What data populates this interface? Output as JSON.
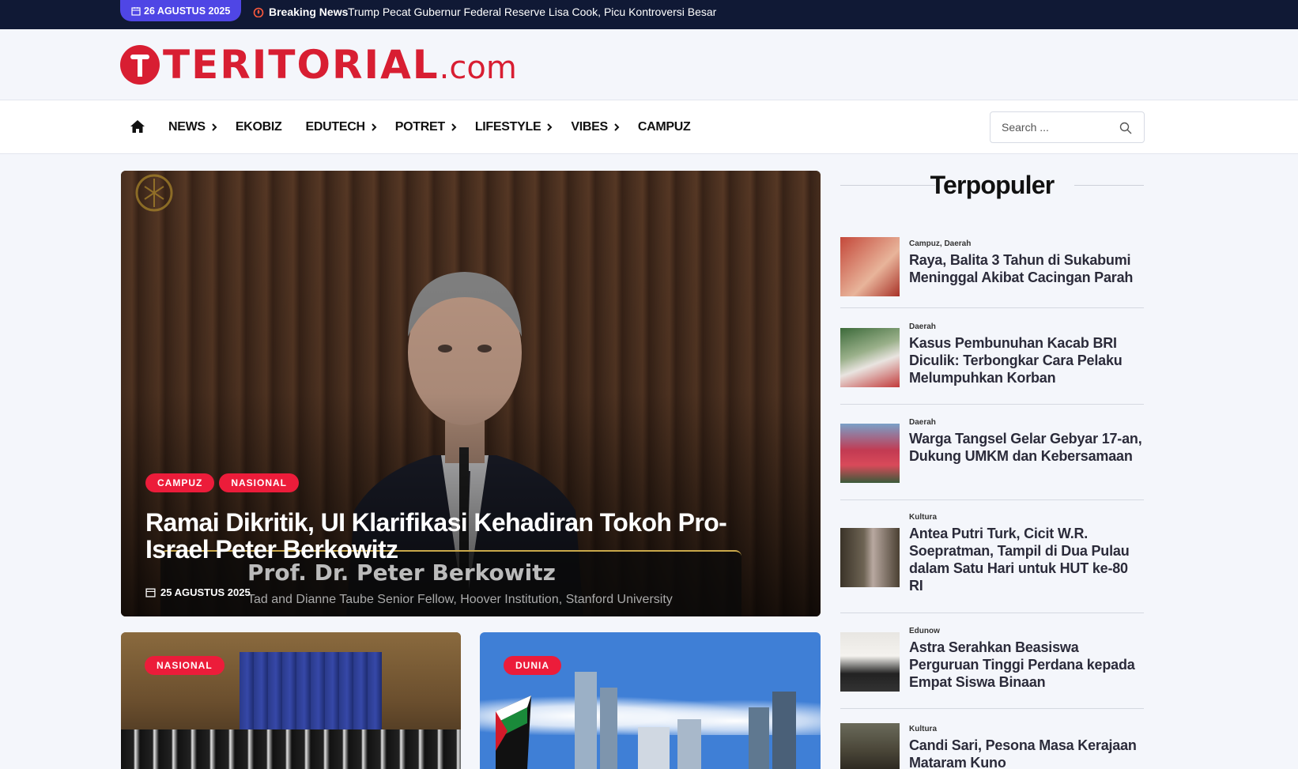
{
  "topbar": {
    "date": "26 AGUSTUS 2025",
    "breaking_label": "Breaking News",
    "ticker_text": "Trump Pecat Gubernur Federal Reserve Lisa Cook, Picu Kontroversi Besar"
  },
  "logo": {
    "main": "TERITORIAL",
    "suffix": ".com",
    "brand_color": "#d81e32"
  },
  "nav": {
    "home_icon": "home-icon",
    "items": [
      {
        "label": "NEWS",
        "has_submenu": true
      },
      {
        "label": "EKOBIZ",
        "has_submenu": false
      },
      {
        "label": "EDUTECH",
        "has_submenu": true
      },
      {
        "label": "POTRET",
        "has_submenu": true
      },
      {
        "label": "LIFESTYLE",
        "has_submenu": true
      },
      {
        "label": "VIBES",
        "has_submenu": true
      },
      {
        "label": "CAMPUZ",
        "has_submenu": false
      }
    ],
    "search_placeholder": "Search ..."
  },
  "hero": {
    "tags": [
      "CAMPUZ",
      "NASIONAL"
    ],
    "title": "Ramai Dikritik, UI Klarifikasi Kehadiran Tokoh Pro-Israel Peter Berkowitz",
    "date": "25 AGUSTUS 2025",
    "caption_name": "Prof. Dr. Peter Berkowitz",
    "caption_role": "Tad and Dianne Taube Senior Fellow, Hoover Institution, Stanford University"
  },
  "cards": [
    {
      "tag": "NASIONAL"
    },
    {
      "tag": "DUNIA"
    }
  ],
  "sidebar": {
    "title": "Terpopuler",
    "items": [
      {
        "category": "Campuz, Daerah",
        "title": "Raya, Balita 3 Tahun di Sukabumi Meninggal Akibat Cacingan Parah"
      },
      {
        "category": "Daerah",
        "title": "Kasus Pembunuhan Kacab BRI Diculik: Terbongkar Cara Pelaku Melumpuhkan Korban"
      },
      {
        "category": "Daerah",
        "title": "Warga Tangsel Gelar Gebyar 17-an, Dukung UMKM dan Kebersamaan"
      },
      {
        "category": "Kultura",
        "title": "Antea Putri Turk, Cicit W.R. Soepratman, Tampil di Dua Pulau dalam Satu Hari untuk HUT ke-80 RI"
      },
      {
        "category": "Edunow",
        "title": "Astra Serahkan Beasiswa Perguruan Tinggi Perdana kepada Empat Siswa Binaan"
      },
      {
        "category": "Kultura",
        "title": "Candi Sari, Pesona Masa Kerajaan Mataram Kuno"
      }
    ]
  },
  "colors": {
    "topbar_bg": "#101935",
    "date_pill": "#4f46e5",
    "tag_red": "#ec1c3a"
  }
}
